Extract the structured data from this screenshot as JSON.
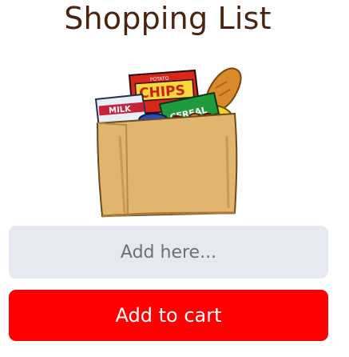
{
  "title": "Shopping List",
  "image": {
    "icon": "grocery-bag-icon",
    "labels": {
      "potato": "POTATO",
      "chips": "CHIPS",
      "milk": "MILK",
      "cereal": "CEREAL"
    }
  },
  "input": {
    "placeholder": "Add here...",
    "value": ""
  },
  "button": {
    "label": "Add to cart"
  },
  "colors": {
    "title": "#4a2410",
    "input_bg": "#e6e9f1",
    "button_bg": "#ff0000",
    "button_text": "#ffffff"
  }
}
